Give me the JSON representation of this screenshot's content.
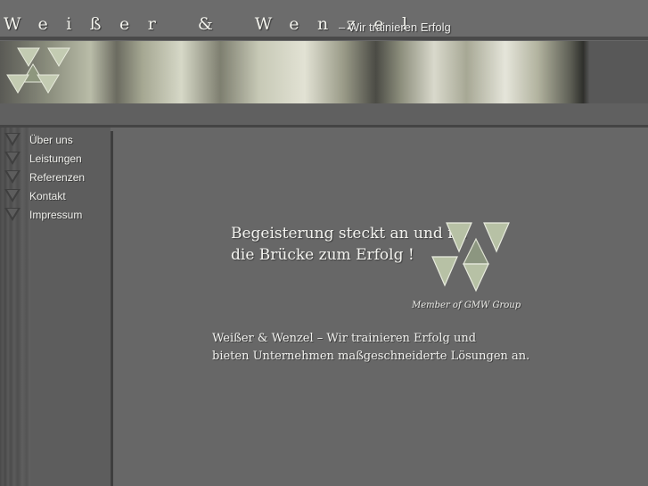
{
  "header": {
    "brand": "Weißer & Wenzel",
    "tagline": "– Wir trainieren Erfolg"
  },
  "nav": {
    "items": [
      {
        "label": "Über uns"
      },
      {
        "label": "Leistungen"
      },
      {
        "label": "Referenzen"
      },
      {
        "label": "Kontakt"
      },
      {
        "label": "Impressum"
      }
    ]
  },
  "main": {
    "hero_line1": "Begeisterung steckt an und ist",
    "hero_line2": "die Brücke zum Erfolg !",
    "member": "Member of GMW Group",
    "intro_line1": "Weißer & Wenzel – Wir trainieren Erfolg und",
    "intro_line2": "bieten Unternehmen maßgeschneiderte Lösungen an."
  },
  "colors": {
    "background": "#676767",
    "text": "#f0f0ec",
    "logo_fill": "#b8c2a6"
  }
}
